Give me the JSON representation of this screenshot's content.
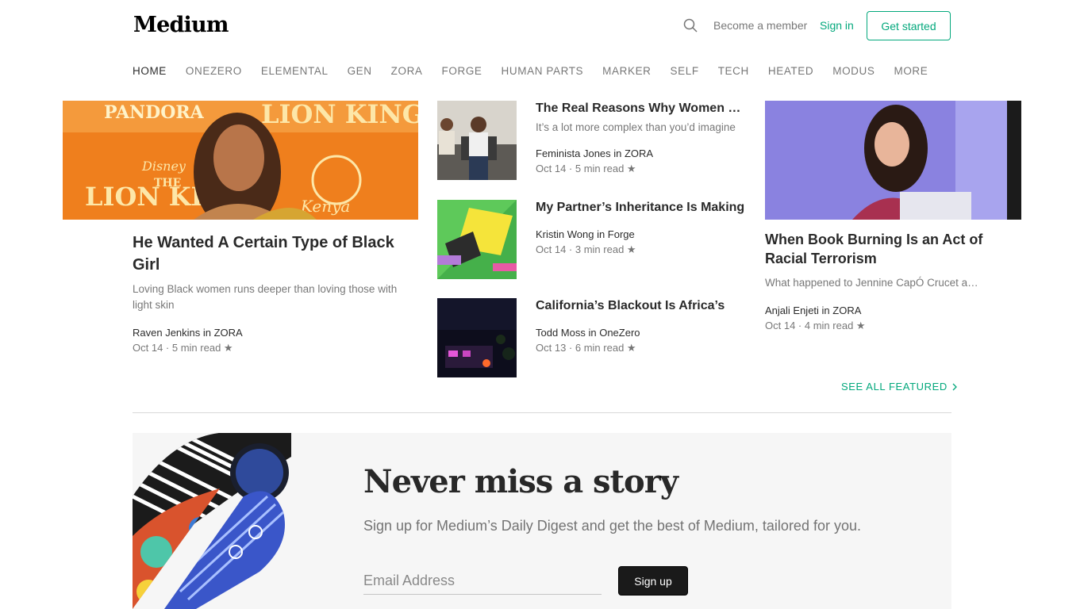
{
  "header": {
    "logo": "Medium",
    "become_member": "Become a member",
    "sign_in": "Sign in",
    "get_started": "Get started"
  },
  "nav": [
    "HOME",
    "ONEZERO",
    "ELEMENTAL",
    "GEN",
    "ZORA",
    "FORGE",
    "HUMAN PARTS",
    "MARKER",
    "SELF",
    "TECH",
    "HEATED",
    "MODUS",
    "MORE"
  ],
  "hero": {
    "title": "He Wanted A Certain Type of Black Girl",
    "subtitle": "Loving Black women runs deeper than loving those with light skin",
    "author": "Raven Jenkins in ZORA",
    "date": "Oct 14",
    "read_time": "5 min read",
    "image_texts": [
      "PANDORA",
      "LION KING",
      "THE",
      "LION KIN",
      "Disney",
      "Kenya"
    ]
  },
  "middle": [
    {
      "title": "The Real Reasons Why Women Cheat",
      "subtitle": "It’s a lot more complex than you’d imagine",
      "author": "Feminista Jones in ZORA",
      "date": "Oct 14",
      "read_time": "5 min read"
    },
    {
      "title": "My Partner’s Inheritance Is Making",
      "subtitle": "",
      "author": "Kristin Wong in Forge",
      "date": "Oct 14",
      "read_time": "3 min read"
    },
    {
      "title": "California’s Blackout Is Africa’s",
      "subtitle": "",
      "author": "Todd Moss in OneZero",
      "date": "Oct 13",
      "read_time": "6 min read"
    }
  ],
  "right": {
    "title": "When Book Burning Is an Act of Racial Terrorism",
    "subtitle": "What happened to Jennine CapÓ Crucet at Georgia Southern",
    "author": "Anjali Enjeti in ZORA",
    "date": "Oct 14",
    "read_time": "4 min read"
  },
  "see_all": "SEE ALL FEATURED",
  "newsletter": {
    "title": "Never miss a story",
    "subtitle": "Sign up for Medium’s Daily Digest and get the best of Medium, tailored for you.",
    "email_placeholder": "Email Address",
    "email_value": "",
    "button": "Sign up"
  },
  "colors": {
    "accent": "#03a87c",
    "text": "#292929",
    "muted": "#757575",
    "button_dark": "#1a1a1a"
  },
  "icons": {
    "search": "search-icon",
    "star": "star-icon",
    "chevron": "chevron-right-icon"
  }
}
